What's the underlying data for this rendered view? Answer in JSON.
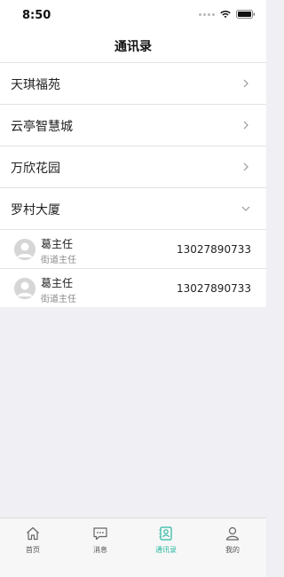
{
  "status_bar": {
    "time": "8:50"
  },
  "header": {
    "title": "通讯录"
  },
  "groups": [
    {
      "label": "天琪福苑",
      "expanded": false
    },
    {
      "label": "云亭智慧城",
      "expanded": false
    },
    {
      "label": "万欣花园",
      "expanded": false
    },
    {
      "label": "罗村大厦",
      "expanded": true
    }
  ],
  "contacts": [
    {
      "name": "葛主任",
      "role": "街道主任",
      "phone": "13027890733"
    },
    {
      "name": "葛主任",
      "role": "街道主任",
      "phone": "13027890733"
    }
  ],
  "tabs": [
    {
      "label": "首页",
      "icon": "home-icon",
      "active": false
    },
    {
      "label": "消息",
      "icon": "message-icon",
      "active": false
    },
    {
      "label": "通讯录",
      "icon": "contacts-icon",
      "active": true
    },
    {
      "label": "我的",
      "icon": "profile-icon",
      "active": false
    }
  ],
  "colors": {
    "active_tab": "#2bb7a2",
    "inactive_tab": "#555555",
    "background": "#efeff4"
  }
}
